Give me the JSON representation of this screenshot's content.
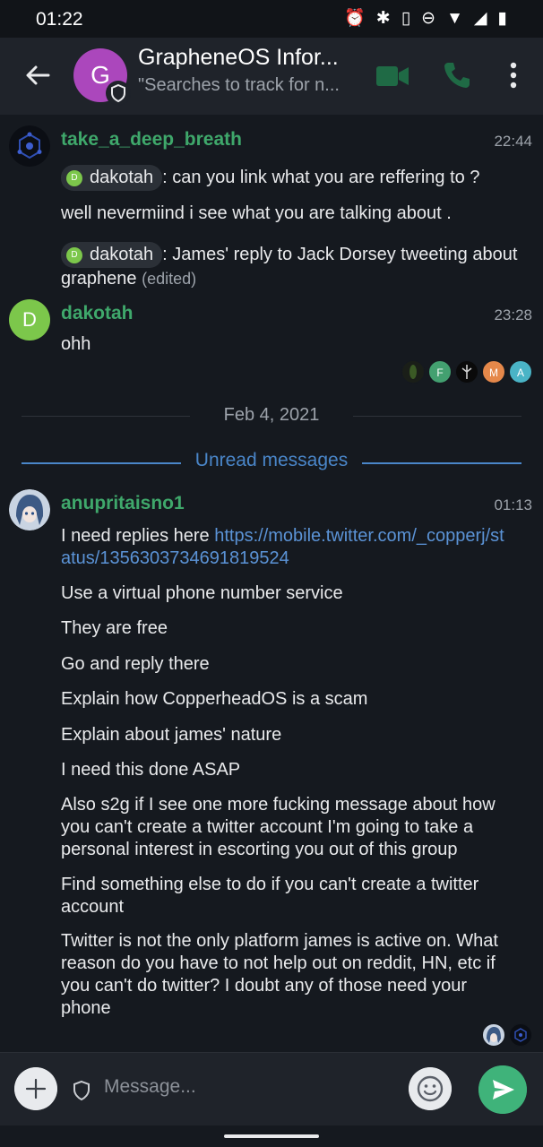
{
  "status_bar": {
    "time": "01:22",
    "icons": [
      "alarm-icon",
      "bluetooth-icon",
      "vibrate-icon",
      "dnd-icon",
      "wifi-icon",
      "signal-icon",
      "battery-icon"
    ]
  },
  "header": {
    "room_initial": "G",
    "room_name": "GrapheneOS Infor...",
    "room_topic": "\"Searches to track for n...",
    "room_avatar_color": "#ab47bc"
  },
  "timeline": {
    "partial_text": "· · · · · · ·",
    "events": [
      {
        "sender": "take_a_deep_breath",
        "time": "22:44",
        "messages": [
          {
            "mention": "dakotah",
            "mention_initial": "D",
            "text": ": can you link what you are reffering to ?"
          },
          {
            "text": "well nevermiind i see what you are talking about ."
          },
          {
            "mention": "dakotah",
            "mention_initial": "D",
            "text": ": James' reply to Jack Dorsey tweeting about graphene",
            "edited": "(edited)"
          }
        ]
      },
      {
        "sender": "dakotah",
        "initial": "D",
        "time": "23:28",
        "messages": [
          {
            "text": "ohh"
          }
        ],
        "read_receipts": [
          "",
          "F",
          "",
          "M",
          "A"
        ]
      }
    ],
    "date_separator": "Feb 4, 2021",
    "unread_label": "Unread messages",
    "unread_event": {
      "sender": "anupritaisno1",
      "time": "01:13",
      "first_message": {
        "text": "I need replies here ",
        "link": "https://mobile.twitter.com/_copperj/status/1356303734691819524"
      },
      "messages": [
        "Use a virtual phone number service",
        "They are free",
        "Go and reply there",
        "Explain how CopperheadOS is a scam",
        "Explain about james' nature",
        "I need this done ASAP",
        "Also s2g if I see one more fucking message about how you can't create a twitter account I'm going to take a personal interest in escorting you out of this group",
        "Find something else to do if you can't create a twitter account",
        "Twitter is not the only platform james is active on. What reason do you have to not help out on reddit, HN, etc if you can't do twitter? I doubt any of those need your phone"
      ]
    }
  },
  "composer": {
    "placeholder": "Message..."
  },
  "colors": {
    "background": "#15191f",
    "bar": "#1f232a",
    "accent_green": "#3fa86b",
    "link_blue": "#5b93d6",
    "unread_blue": "#4a86c9",
    "send_button": "#3fb37a"
  }
}
